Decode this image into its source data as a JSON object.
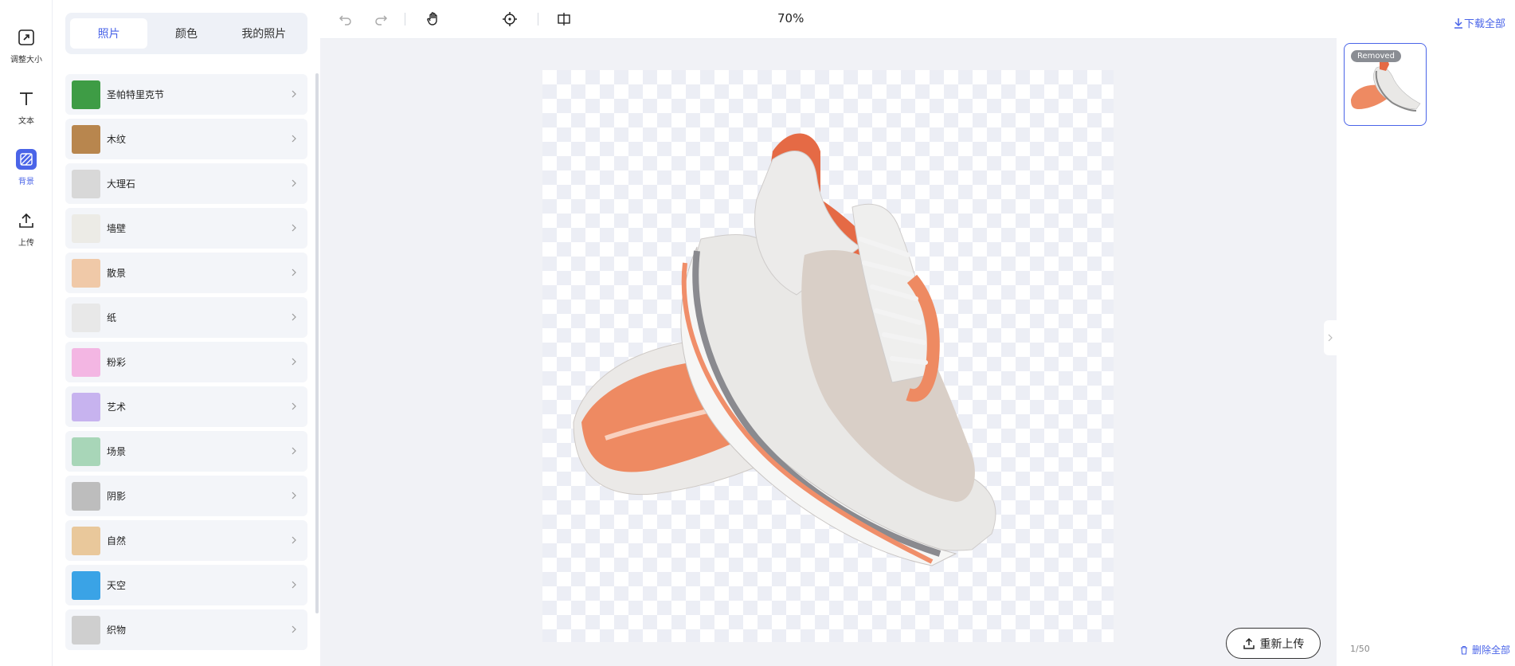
{
  "rail": {
    "items": [
      {
        "label": "调整大小",
        "icon": "resize-icon"
      },
      {
        "label": "文本",
        "icon": "text-icon"
      },
      {
        "label": "背景",
        "icon": "background-icon",
        "active": true
      },
      {
        "label": "上传",
        "icon": "upload-icon"
      }
    ]
  },
  "panel": {
    "tabs": [
      {
        "label": "照片",
        "active": true
      },
      {
        "label": "颜色"
      },
      {
        "label": "我的照片"
      }
    ],
    "categories": [
      {
        "label": "圣帕特里克节",
        "color": "#3e9c45"
      },
      {
        "label": "木纹",
        "color": "#b8864e"
      },
      {
        "label": "大理石",
        "color": "#d8d8d8"
      },
      {
        "label": "墙壁",
        "color": "#ecebe6"
      },
      {
        "label": "散景",
        "color": "#f0c9a8"
      },
      {
        "label": "纸",
        "color": "#e8e8e8"
      },
      {
        "label": "粉彩",
        "color": "#f3b6e3"
      },
      {
        "label": "艺术",
        "color": "#c7b3ef"
      },
      {
        "label": "场景",
        "color": "#a8d6b8"
      },
      {
        "label": "阴影",
        "color": "#bdbdbd"
      },
      {
        "label": "自然",
        "color": "#e9c89b"
      },
      {
        "label": "天空",
        "color": "#3aa3e6"
      },
      {
        "label": "织物",
        "color": "#cfcfcf"
      }
    ]
  },
  "toolbar": {
    "zoom": "70%"
  },
  "canvas": {
    "reupload_label": "重新上传"
  },
  "right": {
    "download_label": "下载全部",
    "badge": "Removed",
    "count": "1/50",
    "delete_label": "删除全部"
  },
  "colors": {
    "accent": "#4a64e8"
  }
}
